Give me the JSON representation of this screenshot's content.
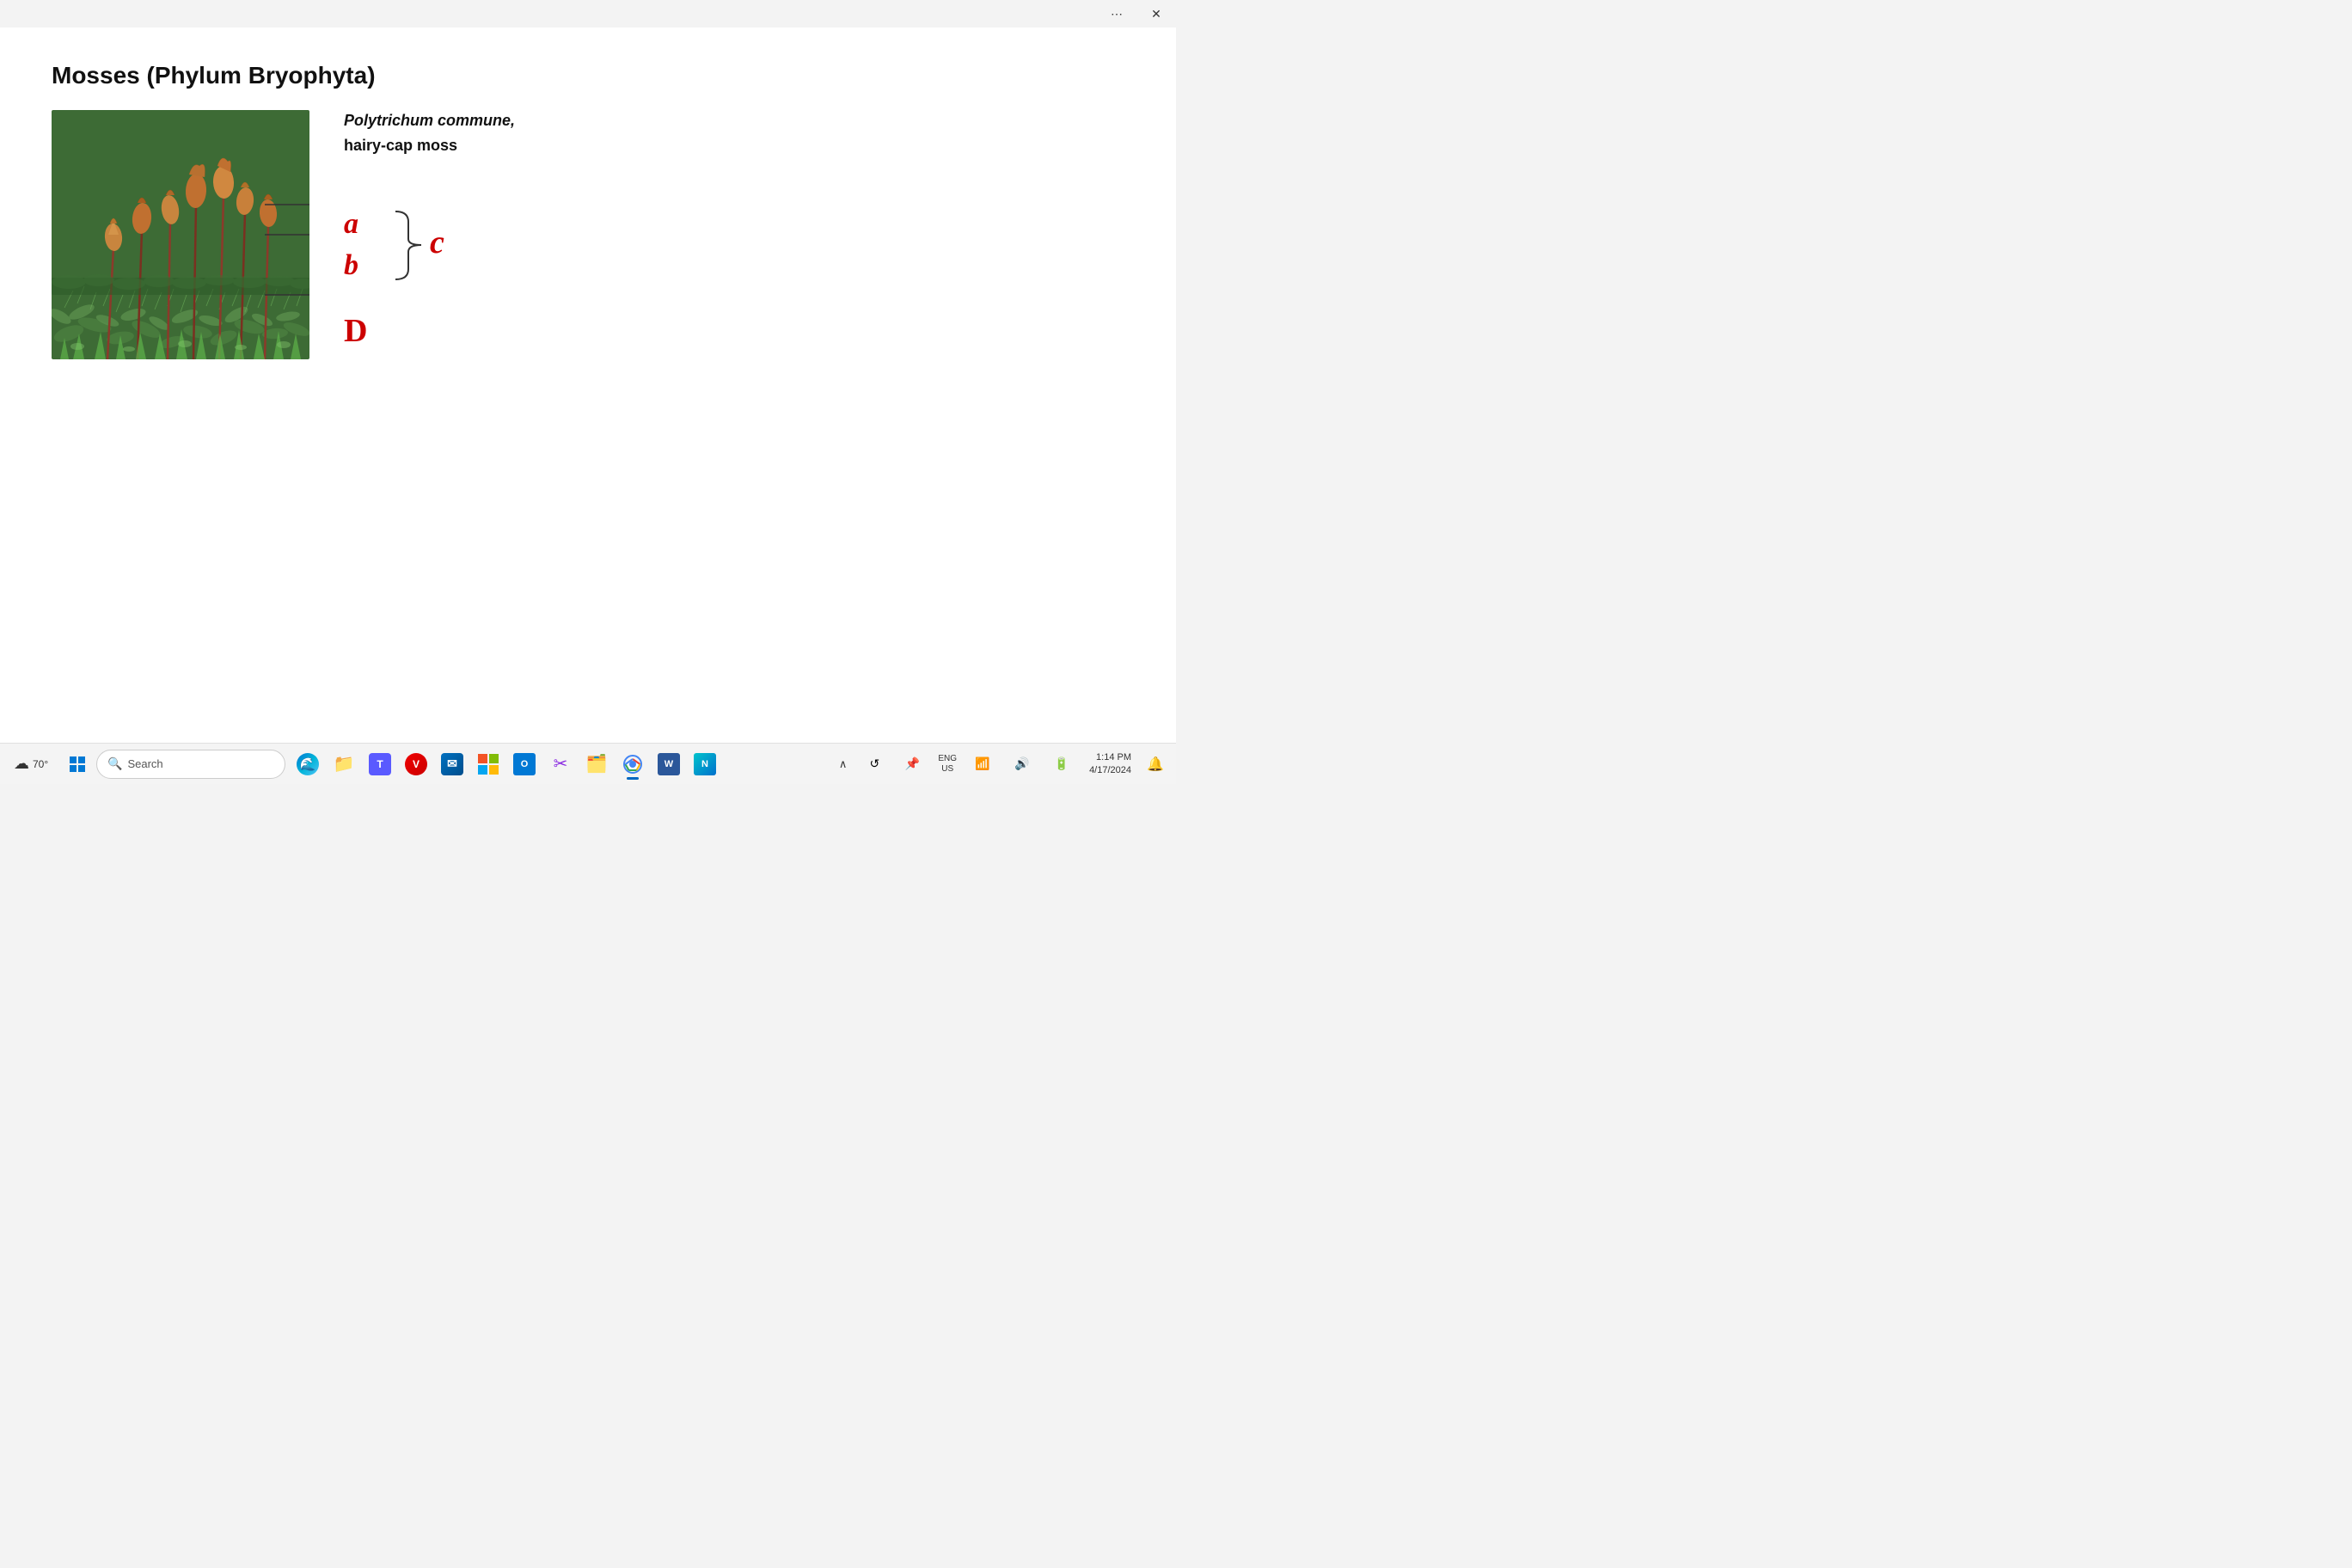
{
  "titlebar": {
    "more_label": "⋯",
    "close_label": "✕"
  },
  "slide": {
    "title": "Mosses (Phylum Bryophyta)",
    "species_line1": "Polytrichum commune,",
    "species_line2": "hairy-cap moss",
    "label_a": "a",
    "label_b": "b",
    "label_c": "c",
    "label_d": "D"
  },
  "taskbar": {
    "weather_temp": "70°",
    "search_placeholder": "Search",
    "clock_time": "1:14 PM",
    "clock_date": "4/17/2024",
    "lang": "ENG",
    "lang_sub": "US",
    "notification_icon": "🔔"
  }
}
